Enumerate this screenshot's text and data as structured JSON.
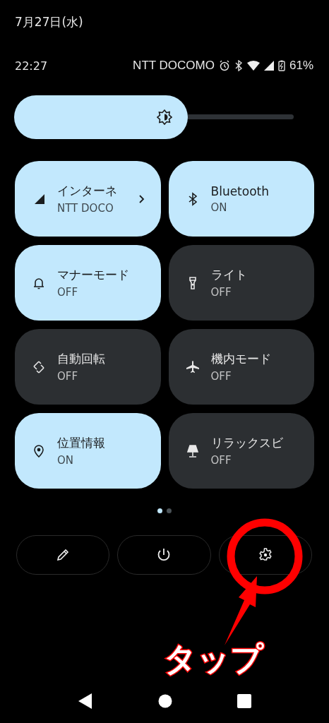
{
  "date": "7月27日(水)",
  "status_bar": {
    "time": "22:27",
    "carrier": "NTT DOCOMO",
    "battery": "61%"
  },
  "brightness": {
    "level": 0.62
  },
  "tiles": [
    {
      "title": "インターネ",
      "state": "NTT DOCO",
      "on": true,
      "expandable": true
    },
    {
      "title": "Bluetooth",
      "state": "ON",
      "on": true,
      "expandable": false
    },
    {
      "title": "マナーモード",
      "state": "OFF",
      "on": true,
      "expandable": false
    },
    {
      "title": "ライト",
      "state": "OFF",
      "on": false,
      "expandable": false
    },
    {
      "title": "自動回転",
      "state": "OFF",
      "on": false,
      "expandable": false
    },
    {
      "title": "機内モード",
      "state": "OFF",
      "on": false,
      "expandable": false
    },
    {
      "title": "位置情報",
      "state": "ON",
      "on": true,
      "expandable": false
    },
    {
      "title": "リラックスビ",
      "state": "OFF",
      "on": false,
      "expandable": false
    }
  ],
  "page_dots": [
    {
      "selected": true
    },
    {
      "selected": false
    }
  ],
  "annotation": {
    "text": "タップ"
  }
}
